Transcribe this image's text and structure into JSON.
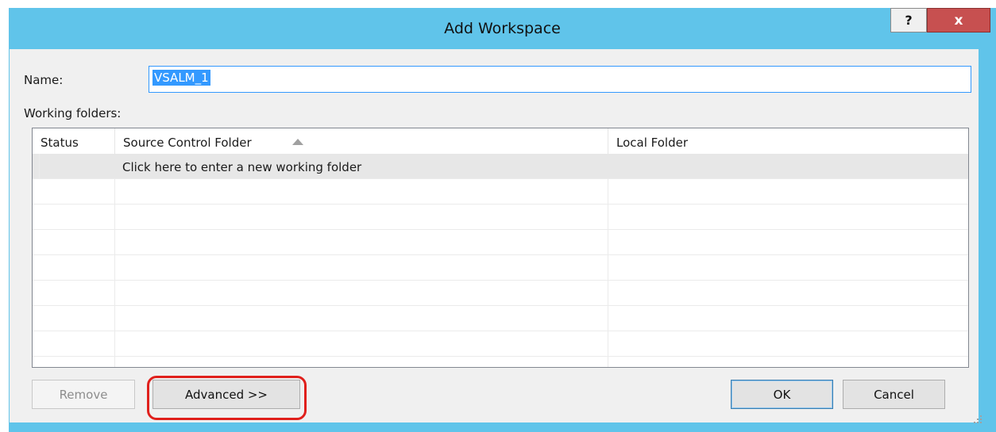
{
  "dialog": {
    "title": "Add Workspace",
    "help_label": "?",
    "close_label": "x"
  },
  "name": {
    "label": "Name:",
    "value": "VSALM_1"
  },
  "working_folders": {
    "label": "Working folders:",
    "columns": {
      "status": "Status",
      "source": "Source Control Folder",
      "local": "Local Folder"
    },
    "sort_column": "source",
    "sort_direction": "ascending",
    "new_row_text": "Click here to enter a new working folder"
  },
  "buttons": {
    "remove": "Remove",
    "advanced": "Advanced >>",
    "ok": "OK",
    "cancel": "Cancel"
  },
  "colors": {
    "title_bar": "#60c4ea",
    "close_button": "#c75050",
    "selection": "#3399ff",
    "highlight_ring": "#e0201c"
  }
}
